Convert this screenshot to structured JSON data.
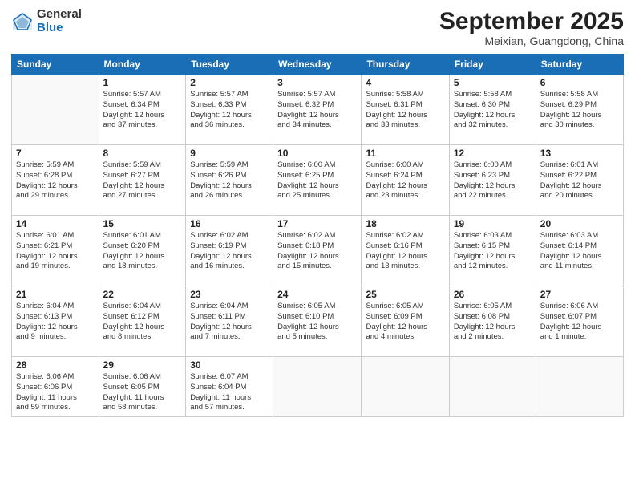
{
  "logo": {
    "general": "General",
    "blue": "Blue"
  },
  "header": {
    "month": "September 2025",
    "location": "Meixian, Guangdong, China"
  },
  "weekdays": [
    "Sunday",
    "Monday",
    "Tuesday",
    "Wednesday",
    "Thursday",
    "Friday",
    "Saturday"
  ],
  "weeks": [
    [
      {
        "day": "",
        "info": ""
      },
      {
        "day": "1",
        "info": "Sunrise: 5:57 AM\nSunset: 6:34 PM\nDaylight: 12 hours\nand 37 minutes."
      },
      {
        "day": "2",
        "info": "Sunrise: 5:57 AM\nSunset: 6:33 PM\nDaylight: 12 hours\nand 36 minutes."
      },
      {
        "day": "3",
        "info": "Sunrise: 5:57 AM\nSunset: 6:32 PM\nDaylight: 12 hours\nand 34 minutes."
      },
      {
        "day": "4",
        "info": "Sunrise: 5:58 AM\nSunset: 6:31 PM\nDaylight: 12 hours\nand 33 minutes."
      },
      {
        "day": "5",
        "info": "Sunrise: 5:58 AM\nSunset: 6:30 PM\nDaylight: 12 hours\nand 32 minutes."
      },
      {
        "day": "6",
        "info": "Sunrise: 5:58 AM\nSunset: 6:29 PM\nDaylight: 12 hours\nand 30 minutes."
      }
    ],
    [
      {
        "day": "7",
        "info": "Sunrise: 5:59 AM\nSunset: 6:28 PM\nDaylight: 12 hours\nand 29 minutes."
      },
      {
        "day": "8",
        "info": "Sunrise: 5:59 AM\nSunset: 6:27 PM\nDaylight: 12 hours\nand 27 minutes."
      },
      {
        "day": "9",
        "info": "Sunrise: 5:59 AM\nSunset: 6:26 PM\nDaylight: 12 hours\nand 26 minutes."
      },
      {
        "day": "10",
        "info": "Sunrise: 6:00 AM\nSunset: 6:25 PM\nDaylight: 12 hours\nand 25 minutes."
      },
      {
        "day": "11",
        "info": "Sunrise: 6:00 AM\nSunset: 6:24 PM\nDaylight: 12 hours\nand 23 minutes."
      },
      {
        "day": "12",
        "info": "Sunrise: 6:00 AM\nSunset: 6:23 PM\nDaylight: 12 hours\nand 22 minutes."
      },
      {
        "day": "13",
        "info": "Sunrise: 6:01 AM\nSunset: 6:22 PM\nDaylight: 12 hours\nand 20 minutes."
      }
    ],
    [
      {
        "day": "14",
        "info": "Sunrise: 6:01 AM\nSunset: 6:21 PM\nDaylight: 12 hours\nand 19 minutes."
      },
      {
        "day": "15",
        "info": "Sunrise: 6:01 AM\nSunset: 6:20 PM\nDaylight: 12 hours\nand 18 minutes."
      },
      {
        "day": "16",
        "info": "Sunrise: 6:02 AM\nSunset: 6:19 PM\nDaylight: 12 hours\nand 16 minutes."
      },
      {
        "day": "17",
        "info": "Sunrise: 6:02 AM\nSunset: 6:18 PM\nDaylight: 12 hours\nand 15 minutes."
      },
      {
        "day": "18",
        "info": "Sunrise: 6:02 AM\nSunset: 6:16 PM\nDaylight: 12 hours\nand 13 minutes."
      },
      {
        "day": "19",
        "info": "Sunrise: 6:03 AM\nSunset: 6:15 PM\nDaylight: 12 hours\nand 12 minutes."
      },
      {
        "day": "20",
        "info": "Sunrise: 6:03 AM\nSunset: 6:14 PM\nDaylight: 12 hours\nand 11 minutes."
      }
    ],
    [
      {
        "day": "21",
        "info": "Sunrise: 6:04 AM\nSunset: 6:13 PM\nDaylight: 12 hours\nand 9 minutes."
      },
      {
        "day": "22",
        "info": "Sunrise: 6:04 AM\nSunset: 6:12 PM\nDaylight: 12 hours\nand 8 minutes."
      },
      {
        "day": "23",
        "info": "Sunrise: 6:04 AM\nSunset: 6:11 PM\nDaylight: 12 hours\nand 7 minutes."
      },
      {
        "day": "24",
        "info": "Sunrise: 6:05 AM\nSunset: 6:10 PM\nDaylight: 12 hours\nand 5 minutes."
      },
      {
        "day": "25",
        "info": "Sunrise: 6:05 AM\nSunset: 6:09 PM\nDaylight: 12 hours\nand 4 minutes."
      },
      {
        "day": "26",
        "info": "Sunrise: 6:05 AM\nSunset: 6:08 PM\nDaylight: 12 hours\nand 2 minutes."
      },
      {
        "day": "27",
        "info": "Sunrise: 6:06 AM\nSunset: 6:07 PM\nDaylight: 12 hours\nand 1 minute."
      }
    ],
    [
      {
        "day": "28",
        "info": "Sunrise: 6:06 AM\nSunset: 6:06 PM\nDaylight: 11 hours\nand 59 minutes."
      },
      {
        "day": "29",
        "info": "Sunrise: 6:06 AM\nSunset: 6:05 PM\nDaylight: 11 hours\nand 58 minutes."
      },
      {
        "day": "30",
        "info": "Sunrise: 6:07 AM\nSunset: 6:04 PM\nDaylight: 11 hours\nand 57 minutes."
      },
      {
        "day": "",
        "info": ""
      },
      {
        "day": "",
        "info": ""
      },
      {
        "day": "",
        "info": ""
      },
      {
        "day": "",
        "info": ""
      }
    ]
  ]
}
